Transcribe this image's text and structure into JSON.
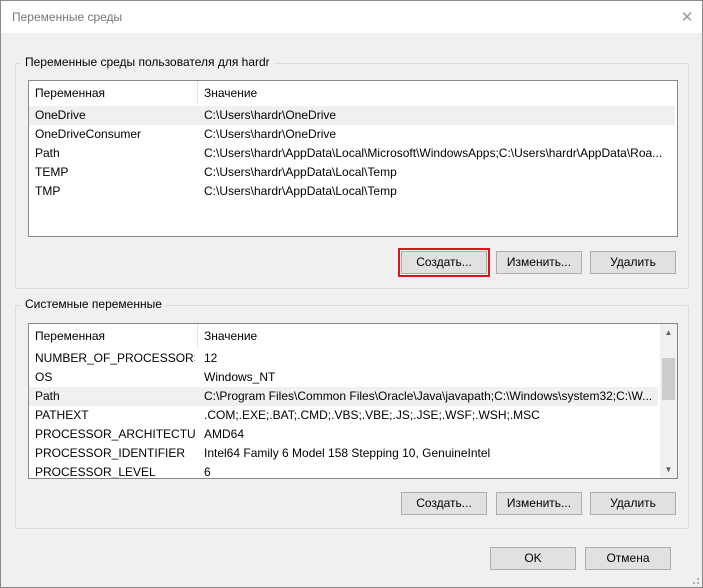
{
  "window": {
    "title": "Переменные среды",
    "close_glyph": "✕"
  },
  "user_group": {
    "label": "Переменные среды пользователя для hardr",
    "columns": [
      "Переменная",
      "Значение"
    ],
    "rows": [
      {
        "name": "OneDrive",
        "value": "C:\\Users\\hardr\\OneDrive"
      },
      {
        "name": "OneDriveConsumer",
        "value": "C:\\Users\\hardr\\OneDrive"
      },
      {
        "name": "Path",
        "value": "C:\\Users\\hardr\\AppData\\Local\\Microsoft\\WindowsApps;C:\\Users\\hardr\\AppData\\Roa..."
      },
      {
        "name": "TEMP",
        "value": "C:\\Users\\hardr\\AppData\\Local\\Temp"
      },
      {
        "name": "TMP",
        "value": "C:\\Users\\hardr\\AppData\\Local\\Temp"
      }
    ],
    "buttons": {
      "create": "Создать...",
      "edit": "Изменить...",
      "delete": "Удалить"
    }
  },
  "system_group": {
    "label": "Системные переменные",
    "columns": [
      "Переменная",
      "Значение"
    ],
    "rows": [
      {
        "name": "NUMBER_OF_PROCESSORS",
        "value": "12"
      },
      {
        "name": "OS",
        "value": "Windows_NT"
      },
      {
        "name": "Path",
        "value": "C:\\Program Files\\Common Files\\Oracle\\Java\\javapath;C:\\Windows\\system32;C:\\W..."
      },
      {
        "name": "PATHEXT",
        "value": ".COM;.EXE;.BAT;.CMD;.VBS;.VBE;.JS;.JSE;.WSF;.WSH;.MSC"
      },
      {
        "name": "PROCESSOR_ARCHITECTURE",
        "value": "AMD64"
      },
      {
        "name": "PROCESSOR_IDENTIFIER",
        "value": "Intel64 Family 6 Model 158 Stepping 10, GenuineIntel"
      },
      {
        "name": "PROCESSOR_LEVEL",
        "value": "6"
      }
    ],
    "buttons": {
      "create": "Создать...",
      "edit": "Изменить...",
      "delete": "Удалить"
    }
  },
  "footer": {
    "ok": "OK",
    "cancel": "Отмена"
  },
  "colors": {
    "highlight": "#e0111b",
    "selected_row": "#f0f0f0"
  }
}
